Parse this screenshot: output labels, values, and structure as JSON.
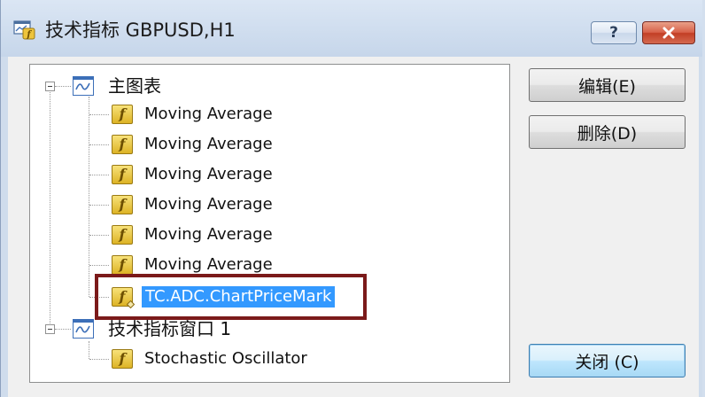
{
  "window": {
    "title": "技术指标 GBPUSD,H1",
    "help_label": "?"
  },
  "tree": {
    "main_chart": {
      "label": "主图表",
      "items": [
        "Moving Average",
        "Moving Average",
        "Moving Average",
        "Moving Average",
        "Moving Average",
        "Moving Average",
        "TC.ADC.ChartPriceMark"
      ],
      "selected_index": 6
    },
    "indicator_window": {
      "label": "技术指标窗口 1",
      "items": [
        "Stochastic Oscillator"
      ]
    }
  },
  "buttons": {
    "edit": "编辑(E)",
    "delete": "删除(D)",
    "close": "关闭 (C)"
  },
  "icons": {
    "chart": "chart-window-icon",
    "indicator": "function-f-icon"
  },
  "colors": {
    "selection": "#3399ff",
    "highlight_frame": "#7b1a1a",
    "close_button": "#c23e25"
  }
}
